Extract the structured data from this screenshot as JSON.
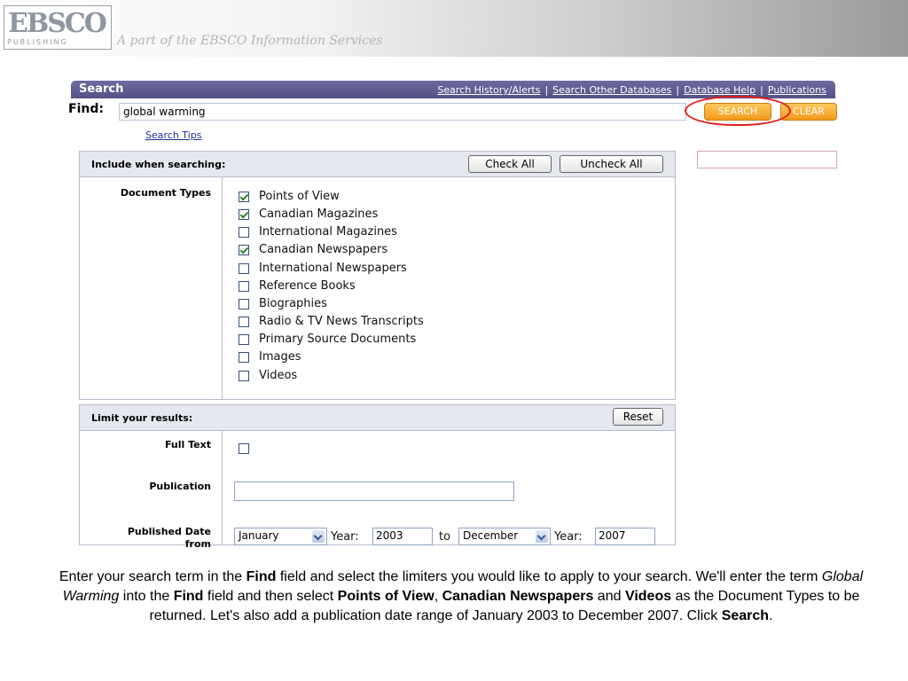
{
  "banner": {
    "logo_main": "EBSCO",
    "logo_sub": "PUBLISHING",
    "tagline": "A part of the EBSCO Information Services"
  },
  "searchbar": {
    "title": "Search",
    "links": [
      "Search History/Alerts",
      "Search Other Databases",
      "Database Help",
      "Publications"
    ]
  },
  "find": {
    "label": "Find:",
    "value": "global warming",
    "search_label": "SEARCH",
    "clear_label": "CLEAR",
    "tips_label": "Search Tips"
  },
  "include": {
    "title": "Include when searching:",
    "check_all": "Check All",
    "uncheck_all": "Uncheck All",
    "document_types_label": "Document Types",
    "document_types": [
      {
        "label": "Points of View",
        "checked": true
      },
      {
        "label": "Canadian Magazines",
        "checked": true
      },
      {
        "label": "International Magazines",
        "checked": false
      },
      {
        "label": "Canadian Newspapers",
        "checked": true
      },
      {
        "label": "International Newspapers",
        "checked": false
      },
      {
        "label": "Reference Books",
        "checked": false
      },
      {
        "label": "Biographies",
        "checked": false
      },
      {
        "label": "Radio & TV News Transcripts",
        "checked": false
      },
      {
        "label": "Primary Source Documents",
        "checked": false
      },
      {
        "label": "Images",
        "checked": false
      },
      {
        "label": "Videos",
        "checked": false
      }
    ]
  },
  "limit": {
    "title": "Limit your results:",
    "reset_label": "Reset",
    "full_text_label": "Full Text",
    "publication_label": "Publication",
    "publication_value": "",
    "date_label_line1": "Published Date",
    "date_label_line2": "from",
    "from_month": "January",
    "year_label": "Year:",
    "from_year": "2003",
    "to_label": "to",
    "to_month": "December",
    "to_year": "2007"
  },
  "instructions": {
    "p1_a": "Enter your search term in the ",
    "p1_find": "Find",
    "p1_b": " field and select the limiters you would like to apply to your search. We'll enter the term ",
    "p1_term": "Global Warming",
    "p1_c": " into the ",
    "p1_find2": "Find",
    "p1_d": " field and then select ",
    "p1_pov": "Points of View",
    "p1_e": ", ",
    "p1_cn": "Canadian Newspapers",
    "p1_f": " and ",
    "p1_vid": "Videos",
    "p1_g": " as the Document Types to be returned. Let's also add a publication date range of January 2003 to December 2007. Click ",
    "p1_search": "Search",
    "p1_h": "."
  },
  "colors": {
    "searchbar": "#5f5c95",
    "search_button": "#f6a020",
    "highlight_oval": "#e31b1b",
    "link": "#1e2e9c"
  }
}
